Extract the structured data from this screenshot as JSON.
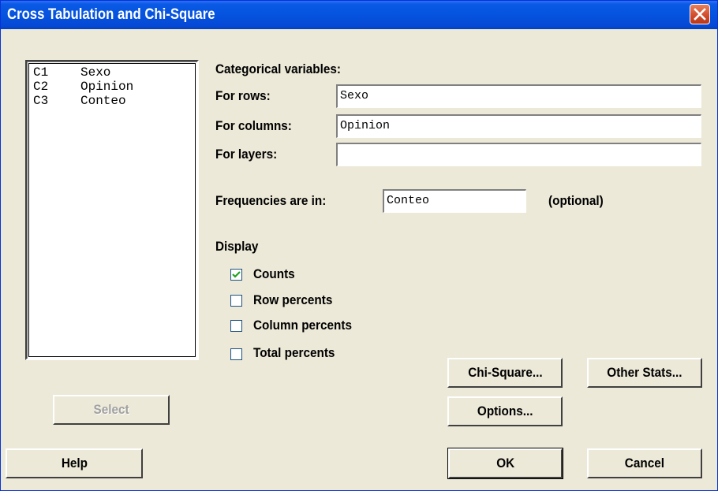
{
  "window": {
    "title": "Cross Tabulation and Chi-Square"
  },
  "columns_list": [
    {
      "col": "C1",
      "name": "Sexo"
    },
    {
      "col": "C2",
      "name": "Opinion"
    },
    {
      "col": "C3",
      "name": "Conteo"
    }
  ],
  "categorical": {
    "heading": "Categorical variables:",
    "rows_label": "For rows:",
    "rows_value": "Sexo",
    "columns_label": "For columns:",
    "columns_value": "Opinion",
    "layers_label": "For layers:",
    "layers_value": ""
  },
  "frequencies": {
    "label": "Frequencies are in:",
    "value": "Conteo",
    "note": "(optional)"
  },
  "display": {
    "heading": "Display",
    "options": [
      {
        "label": "Counts",
        "checked": true
      },
      {
        "label": "Row percents",
        "checked": false
      },
      {
        "label": "Column percents",
        "checked": false
      },
      {
        "label": "Total percents",
        "checked": false
      }
    ]
  },
  "buttons": {
    "select": "Select",
    "help": "Help",
    "chi_square": "Chi-Square...",
    "other_stats": "Other Stats...",
    "options": "Options...",
    "ok": "OK",
    "cancel": "Cancel"
  }
}
